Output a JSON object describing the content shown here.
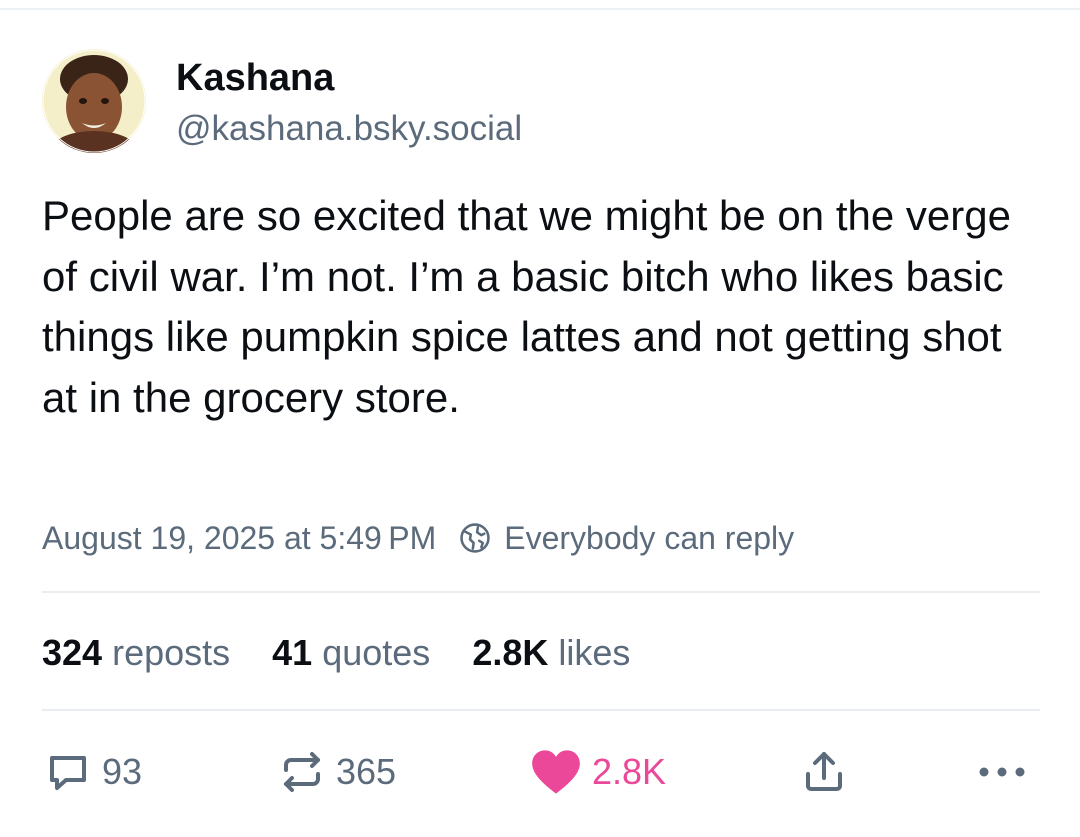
{
  "author": {
    "display_name": "Kashana",
    "handle": "@kashana.bsky.social"
  },
  "post": {
    "text": "People are so excited that we might be on the verge of civil war. I’m not. I’m a basic bitch who likes basic things like pumpkin spice lattes and not getting shot at in the grocery store.",
    "timestamp": "August 19, 2025 at 5:49 PM",
    "reply_setting": "Everybody can reply"
  },
  "stats": {
    "reposts_count": "324",
    "reposts_label": "reposts",
    "quotes_count": "41",
    "quotes_label": "quotes",
    "likes_count": "2.8K",
    "likes_label": "likes"
  },
  "actions": {
    "reply_count": "93",
    "repost_count": "365",
    "like_count": "2.8K",
    "liked": true
  },
  "colors": {
    "text_primary": "#0b0f14",
    "text_secondary": "#5b6b7c",
    "like_pink": "#ec4899",
    "divider": "#e9edf1"
  },
  "icons": [
    "globe-icon",
    "reply-icon",
    "repost-icon",
    "heart-icon",
    "share-icon",
    "more-icon"
  ]
}
